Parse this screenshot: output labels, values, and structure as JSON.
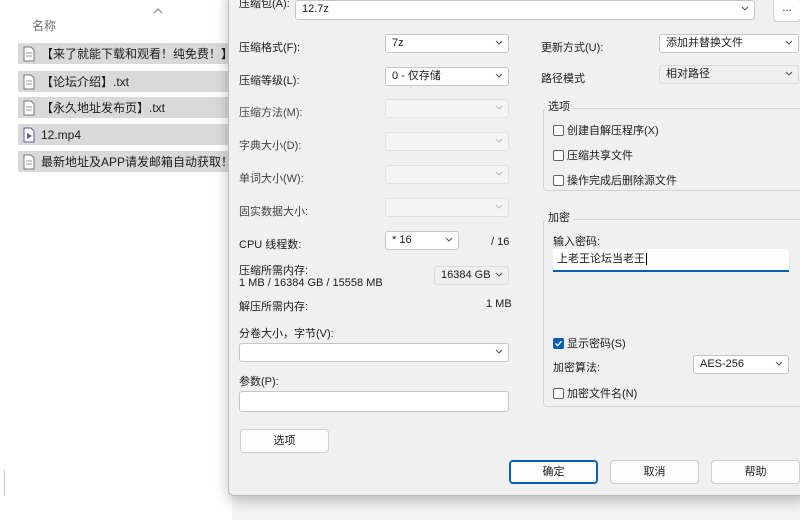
{
  "explorer": {
    "column_header": "名称",
    "files": [
      {
        "name": "【来了就能下载和观看！纯免费！】.txt",
        "icon": "text-file-icon"
      },
      {
        "name": "【论坛介绍】.txt",
        "icon": "text-file-icon"
      },
      {
        "name": "【永久地址发布页】.txt",
        "icon": "text-file-icon"
      },
      {
        "name": "12.mp4",
        "icon": "video-file-icon"
      },
      {
        "name": "最新地址及APP请发邮箱自动获取！！",
        "icon": "text-file-icon"
      }
    ]
  },
  "dialog": {
    "archive_label": "压缩包(A):",
    "archive_value": "12.7z",
    "browse_label": "...",
    "left": {
      "format_label": "压缩格式(F):",
      "format_value": "7z",
      "level_label": "压缩等级(L):",
      "level_value": "0 - 仅存储",
      "method_label": "压缩方法(M):",
      "dict_label": "字典大小(D):",
      "word_label": "单词大小(W):",
      "solid_label": "固实数据大小:",
      "threads_label": "CPU 线程数:",
      "threads_value": "* 16",
      "threads_total": "/ 16",
      "mem_comp_label": "压缩所需内存:",
      "mem_comp_detail": "1 MB / 16384 GB / 15558 MB",
      "mem_comp_value": "16384 GB",
      "mem_decomp_label": "解压所需内存:",
      "mem_decomp_value": "1 MB",
      "split_label": "分卷大小，字节(V):",
      "params_label": "参数(P):",
      "options_button": "选项"
    },
    "right": {
      "update_label": "更新方式(U):",
      "update_value": "添加并替换文件",
      "path_label": "路径模式",
      "path_value": "相对路径",
      "options_group": "选项",
      "sfx_label": "创建自解压程序(X)",
      "shared_label": "压缩共享文件",
      "delete_label": "操作完成后删除源文件",
      "encrypt_group": "加密",
      "password_label": "输入密码:",
      "password_value": "上老王论坛当老王",
      "show_password_label": "显示密码(S)",
      "show_password_checked": true,
      "enc_method_label": "加密算法:",
      "enc_method_value": "AES-256",
      "encrypt_names_label": "加密文件名(N)"
    },
    "buttons": {
      "ok": "确定",
      "cancel": "取消",
      "help": "帮助"
    },
    "accent_color": "#005fb8"
  }
}
